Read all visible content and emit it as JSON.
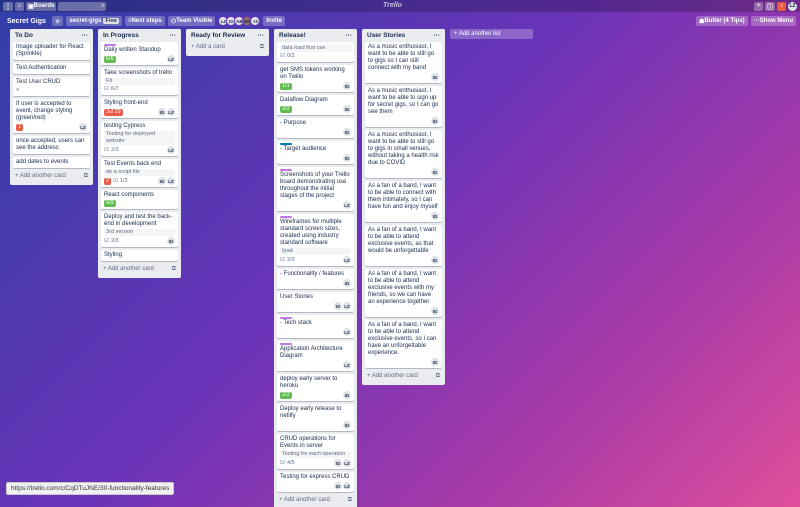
{
  "topbar": {
    "boards": "Boards",
    "search_icon": "⌕",
    "logo": "Trello",
    "icons": [
      "home-icon",
      "add-icon",
      "info-icon",
      "bell-icon"
    ],
    "user": "LZ"
  },
  "boardbar": {
    "title": "Secret Gigs",
    "team": "secret-gigs",
    "free": "Free",
    "next_steps": "Next steps",
    "visibility": "Team Visible",
    "avatars": [
      "LZ",
      "IG",
      "AB",
      "NG"
    ],
    "more": "+2",
    "invite": "Invite",
    "butler": "Butler (4 Tips)",
    "show_menu": "Show Menu"
  },
  "colors": {
    "green": "#61bd4f",
    "red": "#eb5a46",
    "purple": "#c377e0",
    "blue": "#0079bf"
  },
  "lists": [
    {
      "title": "To Do",
      "add": "+ Add another card",
      "cards": [
        {
          "text": "Image uploader for React (Sprinkle)"
        },
        {
          "text": "Test Authentication"
        },
        {
          "text": "Test User CRUD",
          "desc": "≡"
        },
        {
          "text": "If user is accepted to event, change styling (green/red)",
          "badge": "1",
          "badge_color": "red",
          "members": [
            "LZ"
          ]
        },
        {
          "text": "once accepted, users can see the address"
        },
        {
          "text": "add dates to events"
        }
      ]
    },
    {
      "title": "In Progress",
      "add": "+ Add another card",
      "cards": [
        {
          "label": "purple",
          "text": "Daily written Standup",
          "badge": "6/6",
          "badge_color": "green",
          "members": [
            "LZ"
          ]
        },
        {
          "text": "Take screenshots of trello",
          "sub": "Fit",
          "check": "6/7"
        },
        {
          "text": "Styling front-end",
          "badge": "Jul 29",
          "badge_color": "red",
          "members": [
            "IG",
            "LZ"
          ]
        },
        {
          "text": "testing Cypress",
          "sub": "Testing for deployed website",
          "check": "2/3",
          "members": [
            "LZ"
          ]
        },
        {
          "text": "Test Events back end",
          "sub": "do a script file",
          "badge": "2",
          "badge_color": "red",
          "check": "1/2",
          "members": [
            "IG",
            "LZ"
          ]
        },
        {
          "text": "React components",
          "badge": "9/9",
          "badge_color": "green"
        },
        {
          "text": "Deploy and test the back-end in development",
          "sub": "3rd version",
          "check": "2/3",
          "members": [
            "IG"
          ]
        },
        {
          "text": "Styling"
        }
      ]
    },
    {
      "title": "Ready for Review",
      "add": "+ Add a card",
      "cards": []
    },
    {
      "title": "Release!",
      "add": "+ Add another card",
      "cards": [
        {
          "sub": "data load first use",
          "check": "0/2"
        },
        {
          "text": "get SMS tokens working on Twilio",
          "badge": "1/1",
          "badge_color": "green",
          "members": [
            "IG"
          ]
        },
        {
          "text": "Dataflow Diagram",
          "badge": "2/2",
          "badge_color": "green",
          "members": [
            "IG"
          ]
        },
        {
          "text": "- Purpose",
          "members": [
            "IG"
          ]
        },
        {
          "label": "blue",
          "text": "- Target audience",
          "members": [
            "IG"
          ]
        },
        {
          "label": "purple",
          "text": "Screenshots of your Trello board demonstrating use throughout the initial stages of the project",
          "members": [
            "LZ"
          ]
        },
        {
          "label": "purple",
          "text": "Wireframes for multiple standard screen sizes, created using industry standard software",
          "sub": "Ipad",
          "check": "2/3",
          "members": [
            "LZ"
          ]
        },
        {
          "text": "- Functionality / features",
          "members": [
            "IG"
          ]
        },
        {
          "text": "User Stories",
          "members": [
            "IG",
            "LZ"
          ]
        },
        {
          "label": "purple",
          "text": "- Tech stack",
          "members": [
            "LZ"
          ]
        },
        {
          "label": "purple",
          "text": "Application Architecture Diagram",
          "members": [
            "LZ"
          ]
        },
        {
          "text": "deploy early server to heroku",
          "badge": "2/2",
          "badge_color": "green",
          "members": [
            "IG"
          ]
        },
        {
          "text": "Deploy early release to netlify",
          "members": [
            "IG"
          ]
        },
        {
          "text": "CRUD operations for Events in server",
          "sub": "Testing for each operation",
          "check": "4/5",
          "members": [
            "IG",
            "LZ"
          ]
        },
        {
          "text": "Testing for express CRUD",
          "members": [
            "IG",
            "LZ"
          ]
        }
      ]
    },
    {
      "title": "User Stories",
      "add": "+ Add another card",
      "cards": [
        {
          "text": "As a music enthusiast, I want to be able to still go to gigs so I can still connect with my band",
          "members": [
            "IG"
          ]
        },
        {
          "text": "As a music enthusiast, I want to be able to sign up for secret gigs, so I can go see them",
          "members": [
            "IG"
          ]
        },
        {
          "text": "As a music enthusiast, I want to be able to still go to gigs in small venues, without taking a health risk due to COVID",
          "members": [
            "IG"
          ]
        },
        {
          "text": "As a fan of a band, I want to be able to connect with them intimately, so I can have fun and enjoy myself",
          "members": [
            "IG"
          ]
        },
        {
          "text": "As a fan of a band, I want to be able to attend exclusive events, as that would be unforgettable",
          "members": [
            "IG"
          ]
        },
        {
          "text": "As a fan of a band, I want to be able to attend exclusive events with my friends, so we can have an experience together",
          "members": [
            "IG"
          ]
        },
        {
          "text": "As a fan of a band, I want to be able to attend exclusive events, so I can have an unforgettable experience.",
          "members": [
            "IG"
          ]
        }
      ]
    }
  ],
  "add_list": "+ Add another list",
  "status_url": "https://trello.com/c/CqDTuJNE/30-functionality-features"
}
